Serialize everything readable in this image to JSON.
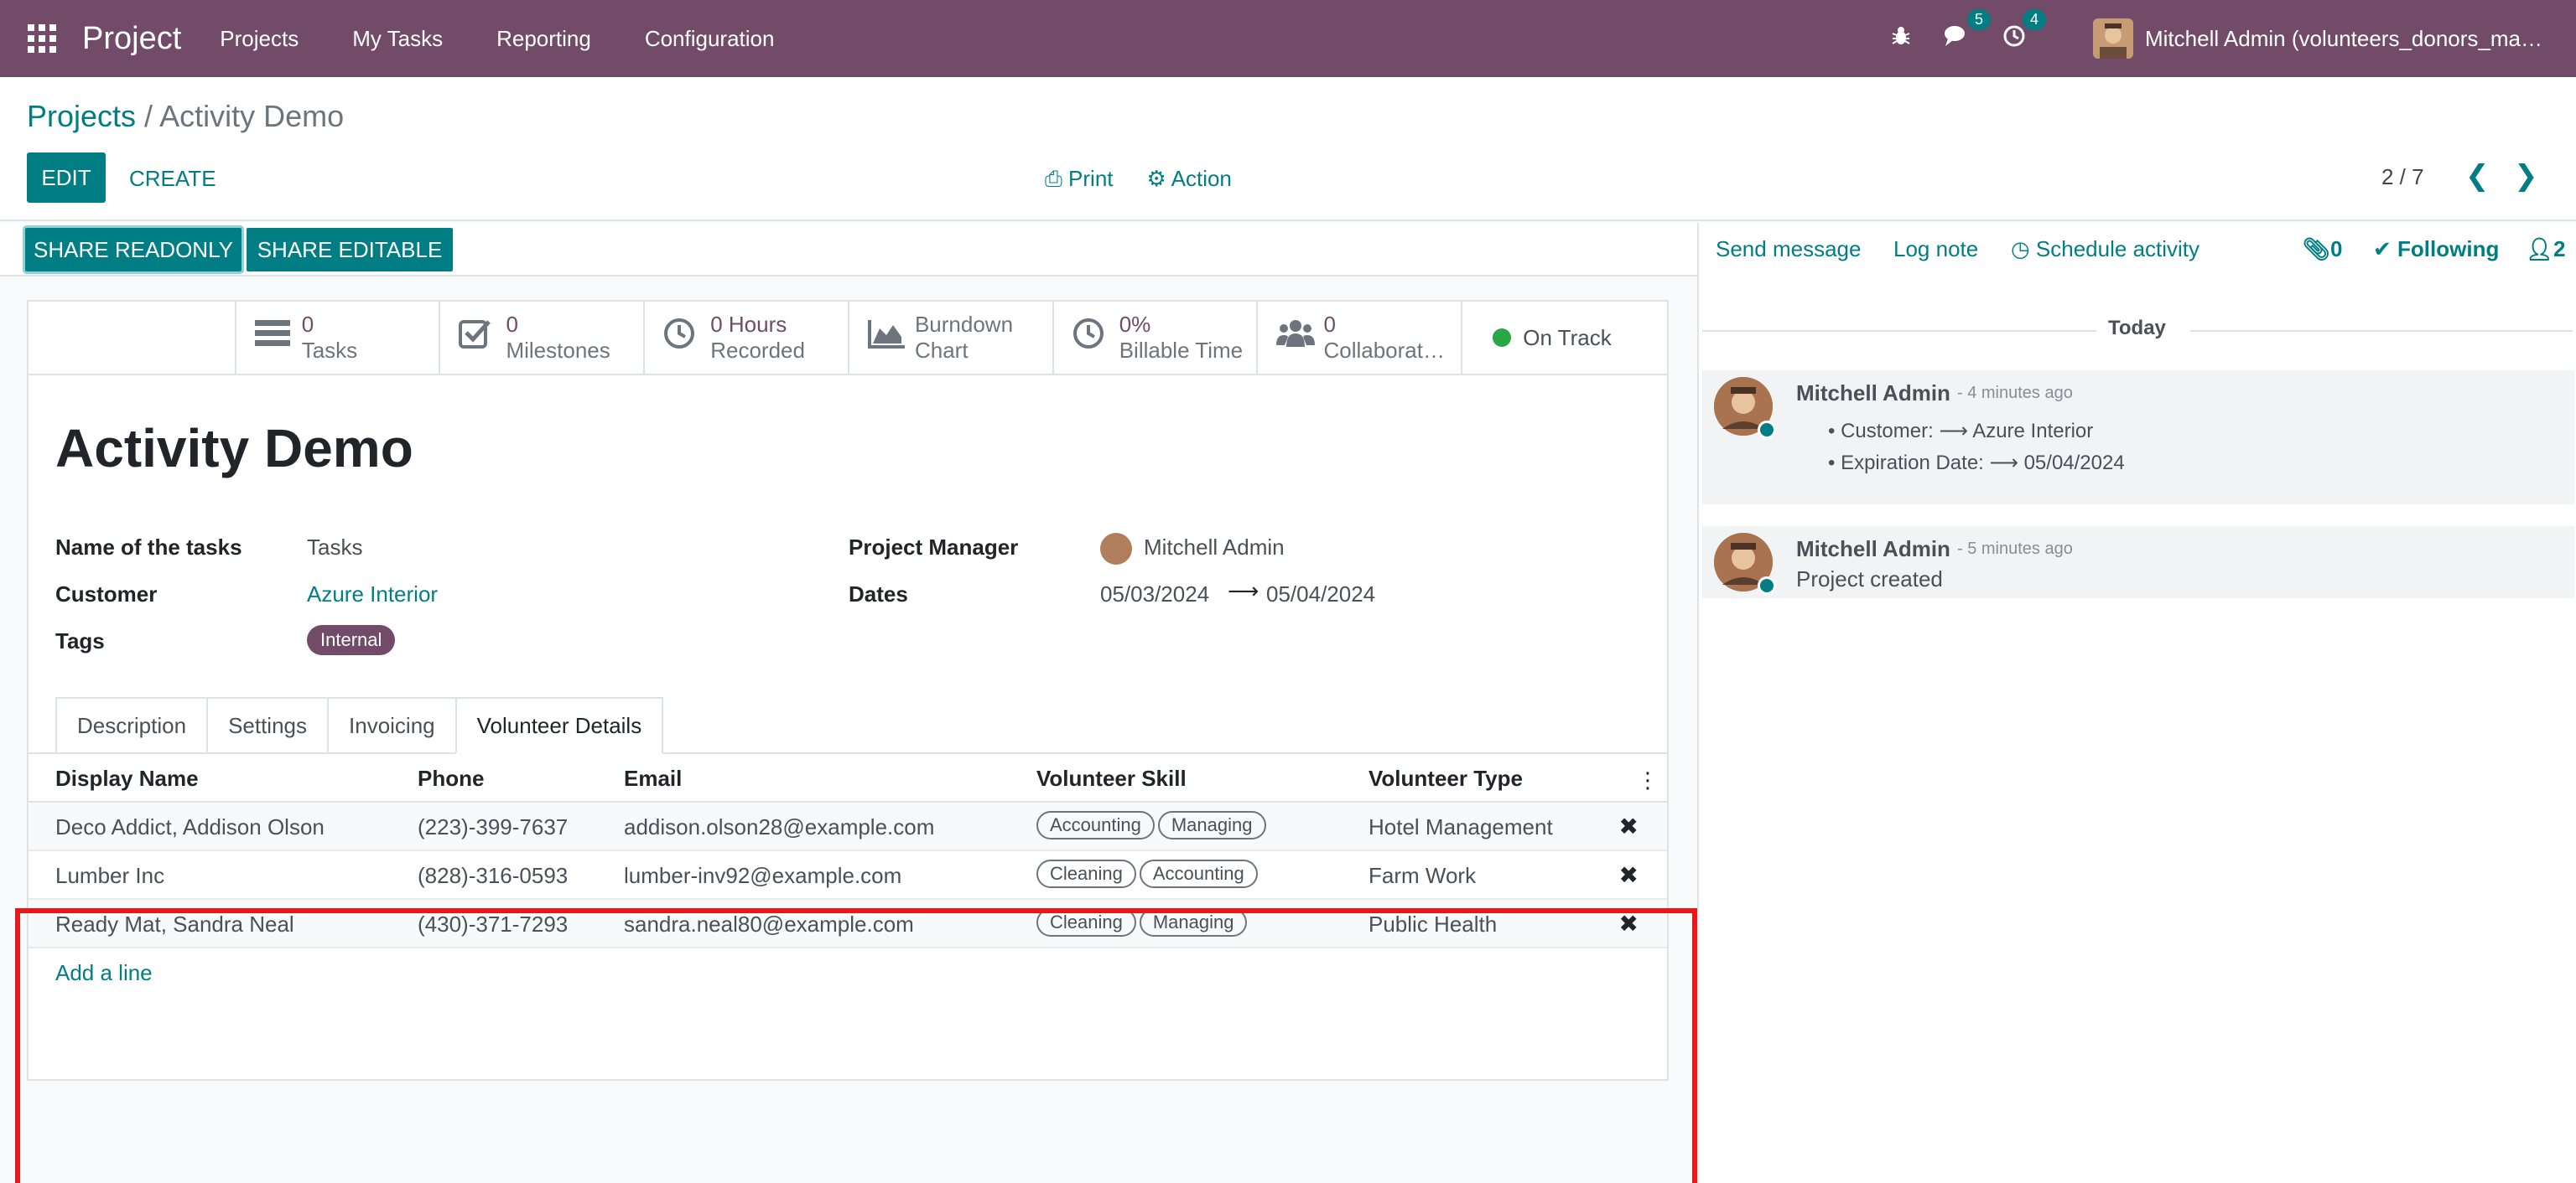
{
  "navbar": {
    "app_name": "Project",
    "menus": [
      "Projects",
      "My Tasks",
      "Reporting",
      "Configuration"
    ],
    "messages_count": "5",
    "activities_count": "4",
    "user": "Mitchell Admin (volunteers_donors_ma…"
  },
  "control": {
    "breadcrumb_parent": "Projects",
    "breadcrumb_sep": " / ",
    "breadcrumb_current": "Activity Demo",
    "edit_label": "EDIT",
    "create_label": "CREATE",
    "print_label": "Print",
    "action_label": "Action",
    "pager": "2 / 7"
  },
  "status_buttons": {
    "share_readonly": "SHARE READONLY",
    "share_editable": "SHARE EDITABLE"
  },
  "stats": [
    {
      "num": "0",
      "label": "Tasks",
      "icon": "tasks-icon"
    },
    {
      "num": "0",
      "label": "Milestones",
      "icon": "check-icon"
    },
    {
      "num": "0 Hours",
      "label": "Recorded",
      "icon": "clock-icon"
    },
    {
      "num": "Burndown",
      "label": "Chart",
      "icon": "area-chart-icon"
    },
    {
      "num": "0%",
      "label": "Billable Time",
      "icon": "clock-icon"
    },
    {
      "num": "0",
      "label": "Collaborat…",
      "icon": "users-icon"
    }
  ],
  "on_track": "On Track",
  "project": {
    "title": "Activity Demo",
    "name_of_tasks_label": "Name of the tasks",
    "name_of_tasks": "Tasks",
    "customer_label": "Customer",
    "customer": "Azure Interior",
    "tags_label": "Tags",
    "tag": "Internal",
    "pm_label": "Project Manager",
    "pm": "Mitchell Admin",
    "dates_label": "Dates",
    "date_start": "05/03/2024",
    "date_end": "05/04/2024"
  },
  "tabs": [
    "Description",
    "Settings",
    "Invoicing",
    "Volunteer Details"
  ],
  "table": {
    "headers": [
      "Display Name",
      "Phone",
      "Email",
      "Volunteer Skill",
      "Volunteer Type"
    ],
    "rows": [
      {
        "name": "Deco Addict, Addison Olson",
        "phone": "(223)-399-7637",
        "email": "addison.olson28@example.com",
        "skills": [
          "Accounting",
          "Managing"
        ],
        "type": "Hotel Management"
      },
      {
        "name": "Lumber Inc",
        "phone": "(828)-316-0593",
        "email": "lumber-inv92@example.com",
        "skills": [
          "Cleaning",
          "Accounting"
        ],
        "type": "Farm Work"
      },
      {
        "name": "Ready Mat, Sandra Neal",
        "phone": "(430)-371-7293",
        "email": "sandra.neal80@example.com",
        "skills": [
          "Cleaning",
          "Managing"
        ],
        "type": "Public Health"
      }
    ],
    "add_line": "Add a line"
  },
  "chatter": {
    "send_message": "Send message",
    "log_note": "Log note",
    "schedule_activity": "Schedule activity",
    "attachments": "0",
    "following": "Following",
    "followers": "2",
    "today": "Today",
    "messages": [
      {
        "author": "Mitchell Admin",
        "time": "- 4 minutes ago",
        "lines": [
          "Customer: ⟶ Azure Interior",
          "Expiration Date: ⟶ 05/04/2024"
        ]
      },
      {
        "author": "Mitchell Admin",
        "time": "- 5 minutes ago",
        "body": "Project created"
      }
    ]
  },
  "colors": {
    "brand": "#714b67",
    "accent": "#017e84",
    "highlight": "#e3191b"
  }
}
